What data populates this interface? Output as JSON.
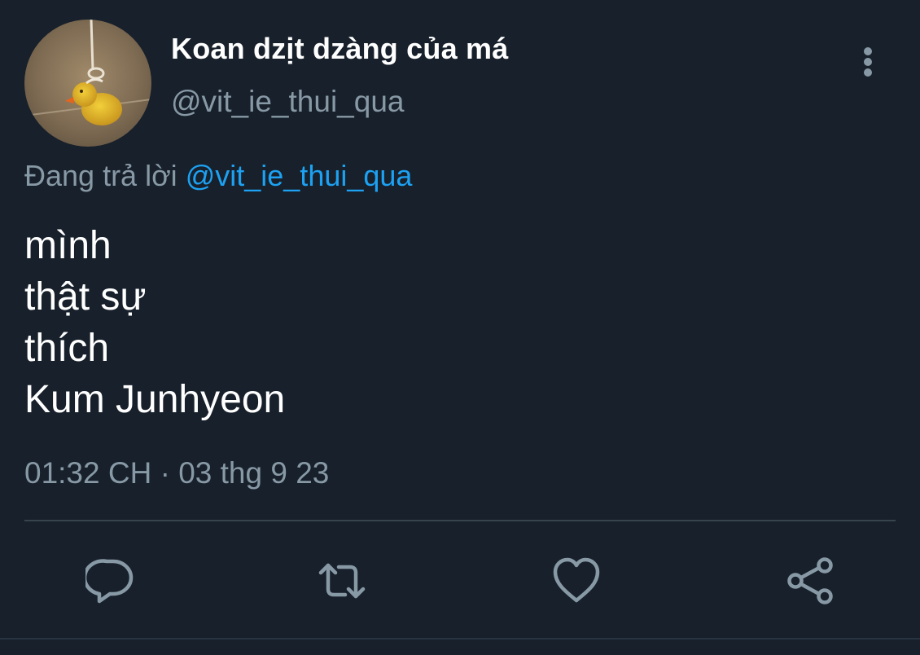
{
  "tweet": {
    "display_name": "Koan dzịt dzàng của má",
    "handle": "@vit_ie_thui_qua",
    "reply_prefix": "Đang trả lời",
    "reply_mention": "@vit_ie_thui_qua",
    "text_lines": [
      "mình",
      "thật sự",
      "thích",
      "Kum Junhyeon"
    ],
    "timestamp": "01:32 CH · 03 thg 9 23"
  },
  "icons": {
    "more": "more-vertical-icon",
    "reply": "reply-icon",
    "retweet": "retweet-icon",
    "like": "heart-icon",
    "share": "share-icon"
  },
  "colors": {
    "background": "#17202b",
    "secondary_text": "#8899a6",
    "mention": "#1da1f2",
    "divider": "#38444d"
  }
}
